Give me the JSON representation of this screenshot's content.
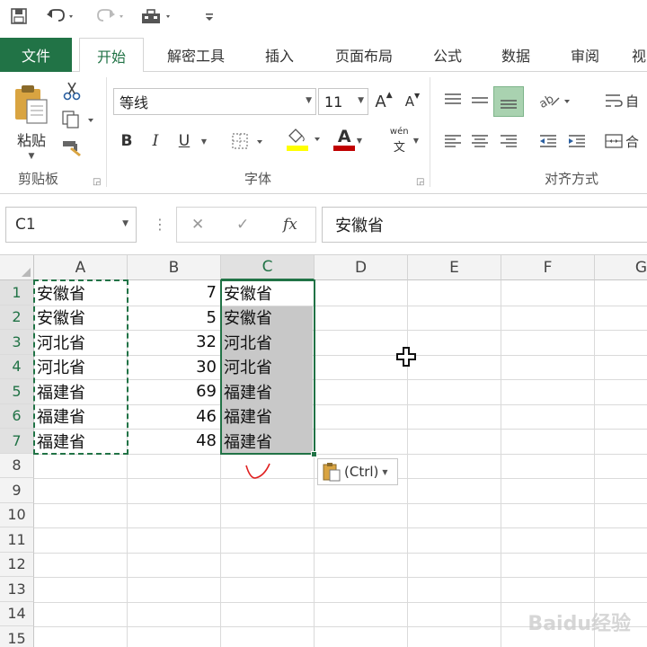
{
  "ribbon_tabs": [
    {
      "label": "文件"
    },
    {
      "label": "开始"
    },
    {
      "label": "解密工具"
    },
    {
      "label": "插入"
    },
    {
      "label": "页面布局"
    },
    {
      "label": "公式"
    },
    {
      "label": "数据"
    },
    {
      "label": "审阅"
    },
    {
      "label": "视"
    }
  ],
  "ribbon": {
    "paste_label": "粘贴",
    "clipboard_label": "剪贴板",
    "font_name": "等线",
    "font_size": "11",
    "font_group_label": "字体",
    "align_group_label": "对齐方式",
    "bold": "B",
    "italic": "I",
    "underline": "U",
    "font_color_letter": "A",
    "grow_font": "A",
    "shrink_font": "A",
    "phonetic_top": "wén",
    "phonetic_bottom": "文",
    "wrap_label": "自",
    "merge_label": "合"
  },
  "formula_bar": {
    "name_box": "C1",
    "fx_label": "fx",
    "content": "安徽省"
  },
  "columns": [
    "A",
    "B",
    "C",
    "D",
    "E",
    "F",
    "G"
  ],
  "selected_column": "C",
  "rows": [
    "1",
    "2",
    "3",
    "4",
    "5",
    "6",
    "7",
    "8",
    "9",
    "10",
    "11",
    "12",
    "13",
    "14",
    "15"
  ],
  "sheet": [
    {
      "a": "安徽省",
      "b": "7",
      "c": "安徽省"
    },
    {
      "a": "安徽省",
      "b": "5",
      "c": "安徽省"
    },
    {
      "a": "河北省",
      "b": "32",
      "c": "河北省"
    },
    {
      "a": "河北省",
      "b": "30",
      "c": "河北省"
    },
    {
      "a": "福建省",
      "b": "69",
      "c": "福建省"
    },
    {
      "a": "福建省",
      "b": "46",
      "c": "福建省"
    },
    {
      "a": "福建省",
      "b": "48",
      "c": "福建省"
    }
  ],
  "paste_options": {
    "label": "(Ctrl)"
  },
  "watermark": {
    "text": "Baidu经验"
  },
  "colors": {
    "accent": "#217346",
    "selection_shade": "#c8c8c8",
    "font_color_bar": "#c00000",
    "highlight_bar": "#ffff00",
    "annotation": "#e02020"
  }
}
